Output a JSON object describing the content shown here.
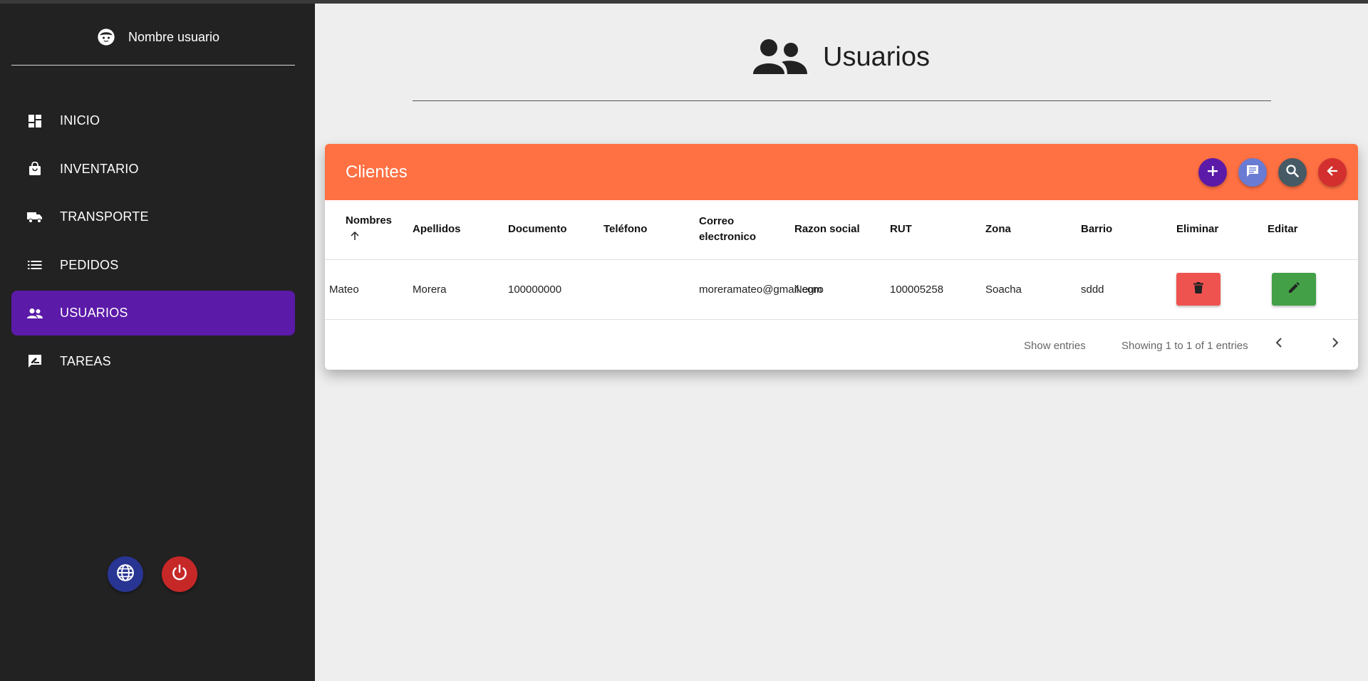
{
  "sidebar": {
    "username": "Nombre usuario",
    "items": [
      {
        "label": "INICIO",
        "icon": "dashboard-icon"
      },
      {
        "label": "INVENTARIO",
        "icon": "shopping-bag-icon"
      },
      {
        "label": "TRANSPORTE",
        "icon": "truck-icon"
      },
      {
        "label": "PEDIDOS",
        "icon": "list-icon"
      },
      {
        "label": "USUARIOS",
        "icon": "people-icon",
        "active": true
      },
      {
        "label": "TAREAS",
        "icon": "rate-review-icon"
      }
    ],
    "bottom_buttons": [
      {
        "icon": "globe-icon",
        "color": "#283593"
      },
      {
        "icon": "power-icon",
        "color": "#c62828"
      }
    ]
  },
  "header": {
    "title": "Usuarios",
    "icon": "people-icon"
  },
  "card": {
    "title": "Clientes",
    "accent": "#ff7043",
    "actions": [
      {
        "icon": "add-icon",
        "color": "#5b1aa8"
      },
      {
        "icon": "chat-icon",
        "color": "#6a7bd3"
      },
      {
        "icon": "search-icon",
        "color": "#455a64"
      },
      {
        "icon": "arrow-back-icon",
        "color": "#d32f2f"
      }
    ],
    "columns": [
      "Nombres",
      "Apellidos",
      "Documento",
      "Teléfono",
      "Correo electronico",
      "Razon social",
      "RUT",
      "Zona",
      "Barrio",
      "Eliminar",
      "Editar"
    ],
    "rows": [
      {
        "nombres": "Mateo",
        "apellidos": "Morera",
        "documento": "100000000",
        "telefono": "",
        "correo": "moreramateo@gmail.com",
        "razon": "Negro",
        "rut": "100005258",
        "zona": "Soacha",
        "barrio": "sddd"
      }
    ],
    "footer": {
      "show_entries": "Show entries",
      "showing": "Showing 1 to 1 of 1 entries"
    }
  }
}
